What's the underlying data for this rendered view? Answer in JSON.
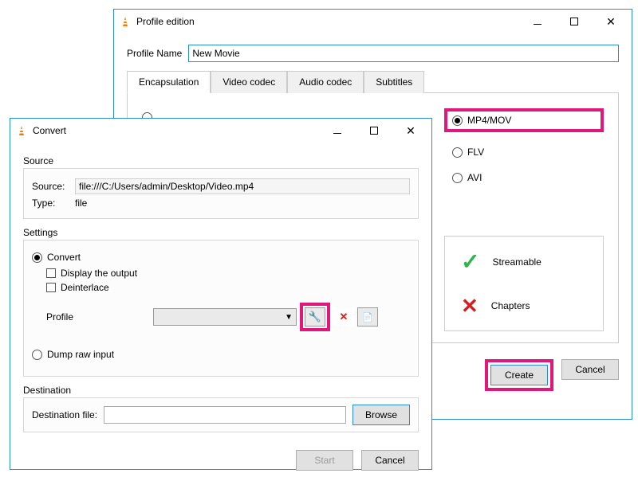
{
  "profile_window": {
    "title": "Profile edition",
    "name_label": "Profile Name",
    "name_value": "New Movie",
    "tabs": {
      "encapsulation": "Encapsulation",
      "video": "Video codec",
      "audio": "Audio codec",
      "subtitles": "Subtitles"
    },
    "formats": {
      "mp4mov": "MP4/MOV",
      "flv": "FLV",
      "avi": "AVI"
    },
    "features": {
      "streamable": "Streamable",
      "chapters": "Chapters"
    },
    "buttons": {
      "create": "Create",
      "cancel": "Cancel"
    }
  },
  "convert_window": {
    "title": "Convert",
    "source_group": "Source",
    "source_label": "Source:",
    "source_value": "file:///C:/Users/admin/Desktop/Video.mp4",
    "type_label": "Type:",
    "type_value": "file",
    "settings_group": "Settings",
    "convert_option": "Convert",
    "display_output": "Display the output",
    "deinterlace": "Deinterlace",
    "profile_label": "Profile",
    "dump_raw": "Dump raw input",
    "destination_group": "Destination",
    "destination_label": "Destination file:",
    "buttons": {
      "browse": "Browse",
      "start": "Start",
      "cancel": "Cancel"
    }
  }
}
